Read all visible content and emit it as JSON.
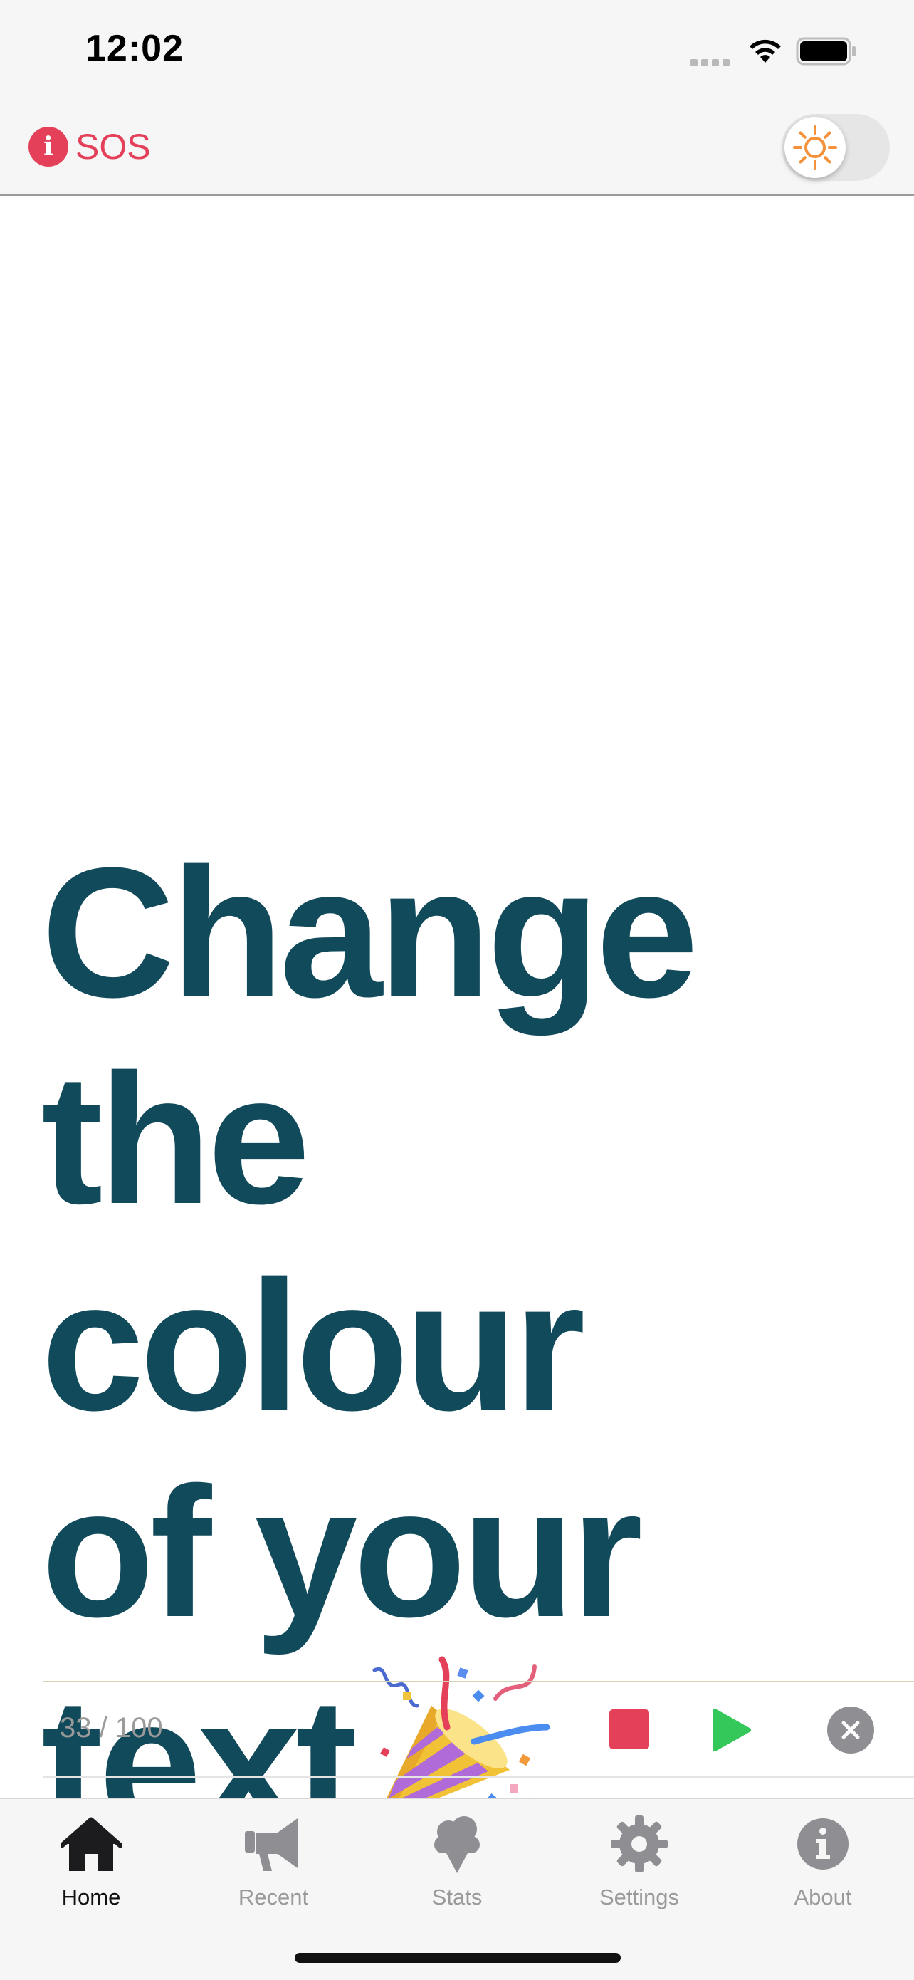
{
  "status_bar": {
    "time": "12:02"
  },
  "header": {
    "sos_badge": "i",
    "sos_label": "SOS"
  },
  "main": {
    "lines": [
      "Change",
      "the colour",
      "of your",
      "text"
    ]
  },
  "controls": {
    "char_count": "33 / 100"
  },
  "tabs": [
    {
      "label": "Home",
      "icon": "house-icon",
      "active": true
    },
    {
      "label": "Recent",
      "icon": "megaphone-icon",
      "active": false
    },
    {
      "label": "Stats",
      "icon": "ice-cream-icon",
      "active": false
    },
    {
      "label": "Settings",
      "icon": "gear-icon",
      "active": false
    },
    {
      "label": "About",
      "icon": "info-icon",
      "active": false
    }
  ],
  "colors": {
    "text": "#114a5a",
    "accent_red": "#e4405a",
    "play_green": "#34c759",
    "sun_orange": "#f4913a"
  }
}
